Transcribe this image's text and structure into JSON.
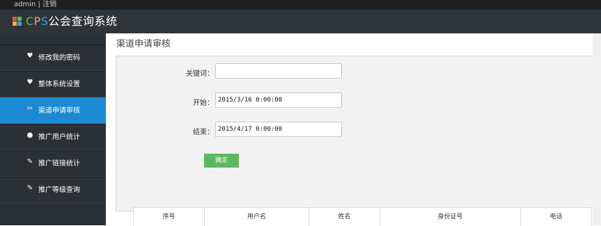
{
  "topbar": {
    "user": "admin",
    "separator": "|",
    "logout": "注销"
  },
  "header": {
    "title_c": "C",
    "title_p": "P",
    "title_s": "S",
    "title_rest": "公会查询系统"
  },
  "sidebar": {
    "items": [
      {
        "label": "修改我的密码",
        "icon": "heart-icon"
      },
      {
        "label": "整体系统设置",
        "icon": "heart-icon"
      },
      {
        "label": "渠道申请审核",
        "icon": "tools-icon",
        "active": true
      },
      {
        "label": "推广用户统计",
        "icon": "drop-icon"
      },
      {
        "label": "推广链接统计",
        "icon": "pencil-icon"
      },
      {
        "label": "推广等级查询",
        "icon": "pencil-icon"
      }
    ]
  },
  "main": {
    "title": "渠道申请审核",
    "form": {
      "keyword_label": "关键词：",
      "keyword_value": "",
      "start_label": "开始：",
      "start_value": "2015/3/16 0:00:00",
      "end_label": "结束：",
      "end_value": "2015/4/17 0:00:00",
      "confirm": "确定"
    },
    "table": {
      "headers": [
        "序号",
        "用户名",
        "姓名",
        "身份证号",
        "电话"
      ]
    }
  },
  "colors": {
    "accent": "#1b8ad3",
    "button": "#5cb85c",
    "sidebar": "#2b3035"
  }
}
